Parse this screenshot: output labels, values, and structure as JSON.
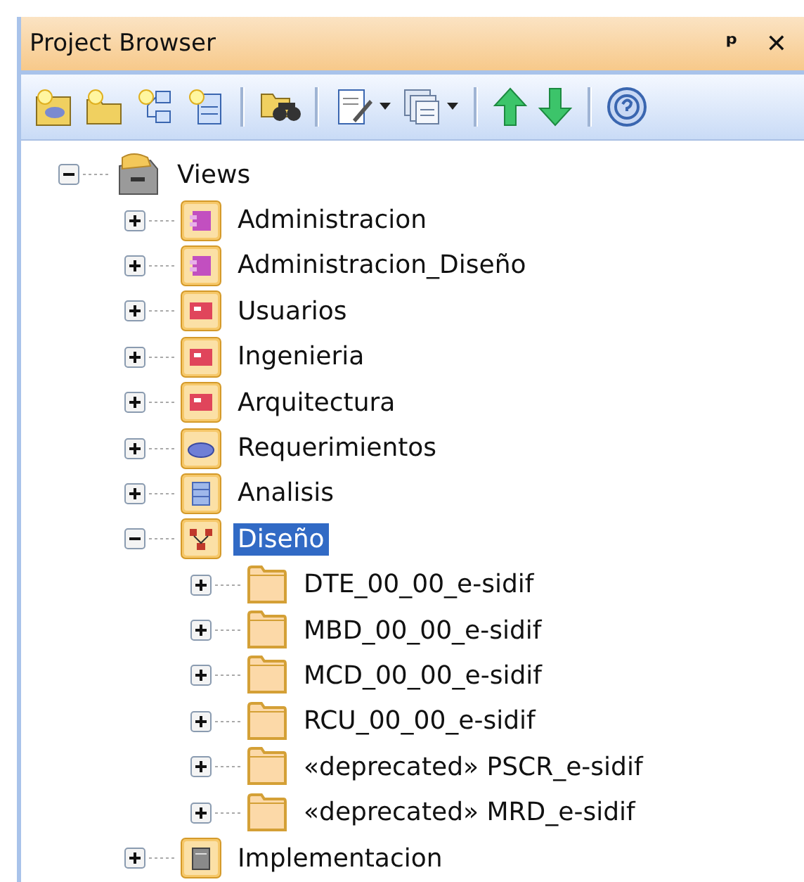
{
  "window": {
    "title": "Project Browser",
    "pin": "ᵖ",
    "close": "✕"
  },
  "tree": [
    {
      "label": "Views",
      "kind": "views",
      "expanded": true,
      "selected": false,
      "children": [
        {
          "label": "Administracion",
          "kind": "component",
          "expanded": false,
          "selected": false
        },
        {
          "label": "Administracion_Diseño",
          "kind": "component",
          "expanded": false,
          "selected": false
        },
        {
          "label": "Usuarios",
          "kind": "usecase",
          "expanded": false,
          "selected": false
        },
        {
          "label": "Ingenieria",
          "kind": "usecase",
          "expanded": false,
          "selected": false
        },
        {
          "label": "Arquitectura",
          "kind": "usecase",
          "expanded": false,
          "selected": false
        },
        {
          "label": "Requerimientos",
          "kind": "requirement",
          "expanded": false,
          "selected": false
        },
        {
          "label": "Analisis",
          "kind": "class",
          "expanded": false,
          "selected": false
        },
        {
          "label": "Diseño",
          "kind": "design",
          "expanded": true,
          "selected": true,
          "children": [
            {
              "label": "DTE_00_00_e-sidif",
              "kind": "folder",
              "expanded": false,
              "selected": false
            },
            {
              "label": "MBD_00_00_e-sidif",
              "kind": "folder",
              "expanded": false,
              "selected": false
            },
            {
              "label": "MCD_00_00_e-sidif",
              "kind": "folder",
              "expanded": false,
              "selected": false
            },
            {
              "label": "RCU_00_00_e-sidif",
              "kind": "folder",
              "expanded": false,
              "selected": false
            },
            {
              "label": "«deprecated» PSCR_e-sidif",
              "kind": "folder",
              "expanded": false,
              "selected": false
            },
            {
              "label": "«deprecated» MRD_e-sidif",
              "kind": "folder",
              "expanded": false,
              "selected": false
            }
          ]
        },
        {
          "label": "Implementacion",
          "kind": "deployment",
          "expanded": false,
          "selected": false
        }
      ]
    }
  ]
}
